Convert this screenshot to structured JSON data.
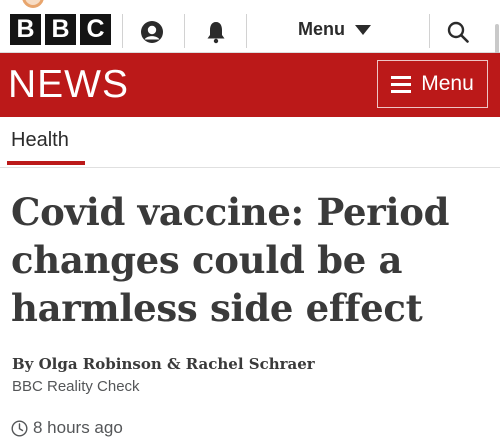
{
  "masthead": {
    "logo_letters": [
      "B",
      "B",
      "C"
    ],
    "account_icon": "user-icon",
    "notifications_icon": "bell-icon",
    "menu_label": "Menu",
    "menu_icon": "caret-down-icon",
    "search_icon": "search-icon"
  },
  "news_bar": {
    "title": "NEWS",
    "menu_label": "Menu",
    "menu_icon": "hamburger-icon",
    "background_color": "#bb1919"
  },
  "section": {
    "label": "Health",
    "accent_color": "#bb1919"
  },
  "article": {
    "headline": "Covid vaccine: Period changes could be a harmless side effect",
    "byline": "By Olga Robinson & Rachel Schraer",
    "byline_role": "BBC Reality Check",
    "timestamp": "8 hours ago",
    "timestamp_icon": "clock-icon"
  }
}
